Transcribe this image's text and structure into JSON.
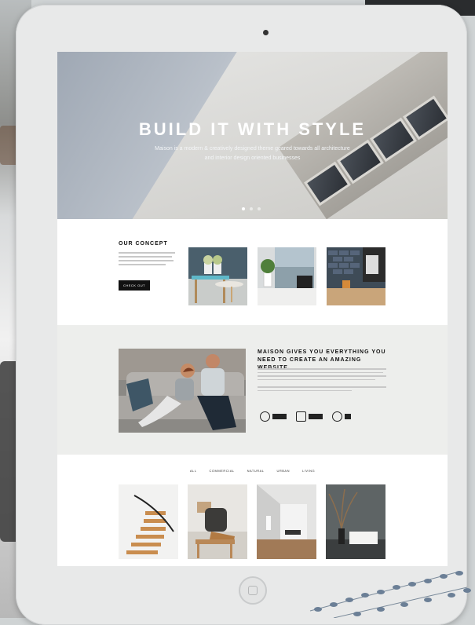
{
  "hero": {
    "title": "BUILD IT WITH STYLE",
    "subtitle_line1": "Maison is a modern & creatively designed theme geared towards all architecture",
    "subtitle_line2": "and interior design oriented businesses",
    "slides": 3,
    "active_slide": 1
  },
  "concept": {
    "heading": "OUR CONCEPT",
    "button_label": "CHECK OUT"
  },
  "maison": {
    "heading": "MAISON GIVES YOU EVERYTHING YOU NEED TO CREATE AN AMAZING WEBSITE."
  },
  "portfolio": {
    "filters": [
      "ALL",
      "COMMERCIAL",
      "NATURAL",
      "URBAN",
      "LIVING"
    ]
  },
  "colors": {
    "accent": "#111111",
    "section_grey": "#edeeec",
    "tablet_frame": "#e8e9e9"
  }
}
